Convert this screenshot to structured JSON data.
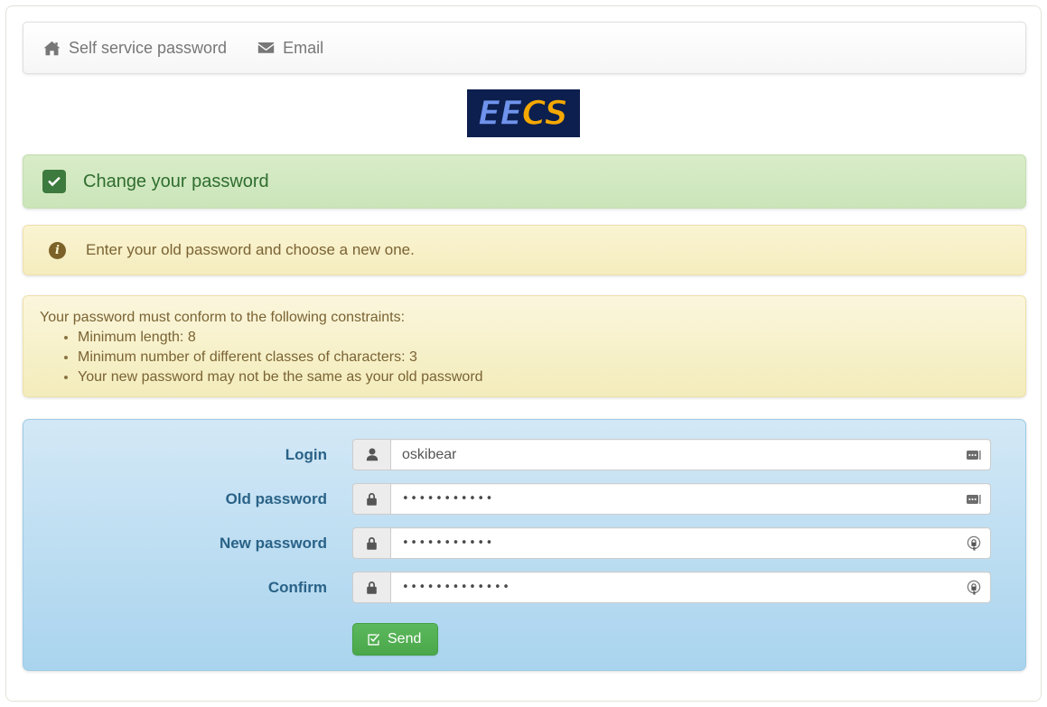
{
  "navbar": {
    "items": [
      {
        "label": "Self service password",
        "icon": "home-icon"
      },
      {
        "label": "Email",
        "icon": "envelope-icon"
      }
    ]
  },
  "logo": {
    "part1": "EE",
    "part2": "CS",
    "bg_color": "#0d1f4e",
    "part1_color": "#6f93ec",
    "part2_color": "#f5a800"
  },
  "success_panel": {
    "title": "Change your password",
    "icon": "check-square-icon",
    "bg_color": "#d0e8bf",
    "text_color": "#2f6d2f"
  },
  "info_alert": {
    "text": "Enter your old password and choose a new one.",
    "icon": "info-circle-icon",
    "bg_color": "#f7efc8",
    "text_color": "#7a6334"
  },
  "constraints": {
    "intro": "Your password must conform to the following constraints:",
    "items": [
      "Minimum length: 8",
      "Minimum number of different classes of characters: 3",
      "Your new password may not be the same as your old password"
    ]
  },
  "form": {
    "accent_color": "#2a6287",
    "bg_color": "#bcdef3",
    "fields": [
      {
        "label": "Login",
        "value": "oskibear",
        "placeholder": "Login",
        "type": "text",
        "addon_icon": "user-icon",
        "trailing_icon": "show-password-icon"
      },
      {
        "label": "Old password",
        "value": "•••••••••••",
        "placeholder": "Old password",
        "type": "password",
        "addon_icon": "lock-icon",
        "trailing_icon": "show-password-icon"
      },
      {
        "label": "New password",
        "value": "•••••••••••",
        "placeholder": "New password",
        "type": "password",
        "addon_icon": "lock-icon",
        "trailing_icon": "generate-password-icon"
      },
      {
        "label": "Confirm",
        "value": "•••••••••••••",
        "placeholder": "Confirm",
        "type": "password",
        "addon_icon": "lock-icon",
        "trailing_icon": "generate-password-icon"
      }
    ],
    "submit": {
      "label": "Send",
      "icon": "check-square-outline-icon",
      "color": "#5cb85c"
    }
  }
}
